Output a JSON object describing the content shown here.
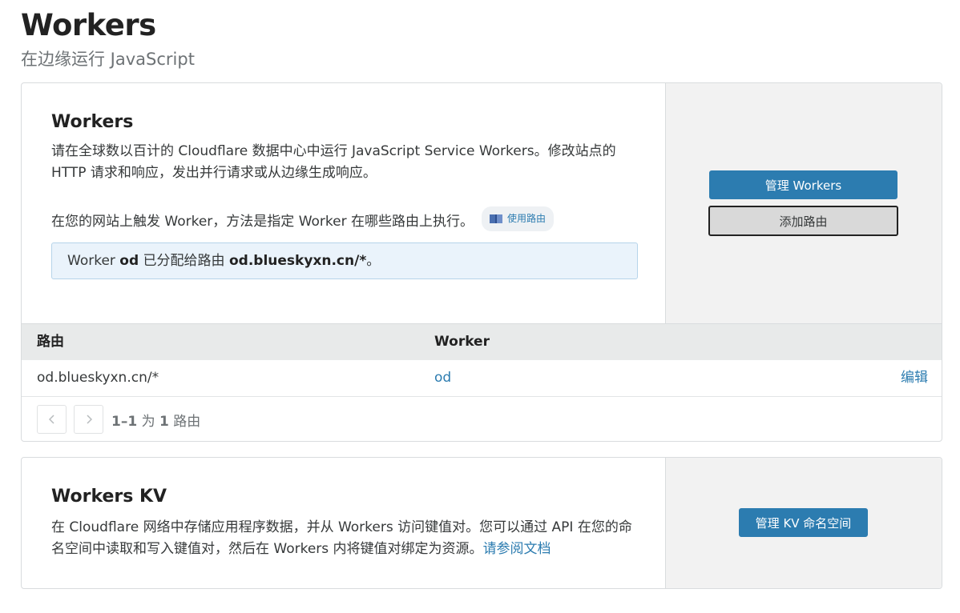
{
  "header": {
    "title": "Workers",
    "subtitle": "在边缘运行 JavaScript"
  },
  "workers_card": {
    "heading": "Workers",
    "description": "请在全球数以百计的 Cloudflare 数据中心中运行 JavaScript Service Workers。修改站点的 HTTP 请求和响应，发出并行请求或从边缘生成响应。",
    "trigger_text": "在您的网站上触发 Worker，方法是指定 Worker 在哪些路由上执行。",
    "routes_pill_label": "使用路由",
    "info": {
      "prefix": "Worker ",
      "worker_name": "od",
      "middle": " 已分配给路由 ",
      "route": "od.blueskyxn.cn/*",
      "suffix": "。"
    },
    "manage_button": "管理 Workers",
    "add_route_button": "添加路由",
    "table": {
      "headers": {
        "route": "路由",
        "worker": "Worker"
      },
      "rows": [
        {
          "route": "od.blueskyxn.cn/*",
          "worker": "od",
          "action": "编辑"
        }
      ]
    },
    "pagination": {
      "range": "1–1",
      "of_label": "为",
      "total": "1",
      "unit": "路由",
      "prev_icon": "chevron-left-icon",
      "next_icon": "chevron-right-icon"
    }
  },
  "kv_card": {
    "heading": "Workers KV",
    "description": "在 Cloudflare 网络中存储应用程序数据，并从 Workers 访问键值对。您可以通过 API 在您的命名空间中读取和写入键值对，然后在 Workers 内将键值对绑定为资源。",
    "docs_link": "请参阅文档",
    "manage_button": "管理 KV 命名空间"
  },
  "colors": {
    "accent": "#2c7cb0",
    "info_bg": "#eaf3fb",
    "panel_bg": "#f2f2f2"
  }
}
